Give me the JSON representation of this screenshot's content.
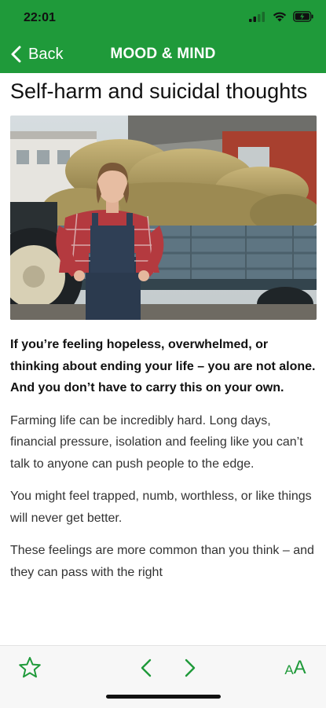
{
  "status_bar": {
    "time": "22:01"
  },
  "nav": {
    "back_label": "Back",
    "title": "MOOD & MIND"
  },
  "article": {
    "title": "Self-harm and suicidal thoughts",
    "hero_image_alt": "farmer-with-hay-bales",
    "lead": "If you’re feeling hopeless, overwhelmed, or thinking about ending your life – you are not alone. And you don’t have to carry this on your own.",
    "paragraphs": [
      "Farming life can be incredibly hard. Long days, financial pressure, isolation and feeling like you can’t talk to anyone can push people to the edge.",
      "You might feel trapped, numb, worthless, or like things will never get better.",
      "These feelings are more common than you think – and they can pass with the right"
    ]
  },
  "toolbar": {
    "text_size_small": "A",
    "text_size_big": "A"
  },
  "colors": {
    "brand_green": "#1f9a3a",
    "toolbar_bg": "#f7f7f7"
  },
  "icons": [
    "back-chevron-icon",
    "star-icon",
    "chevron-left-icon",
    "chevron-right-icon",
    "text-size-icon",
    "signal-icon",
    "wifi-icon",
    "battery-icon"
  ]
}
